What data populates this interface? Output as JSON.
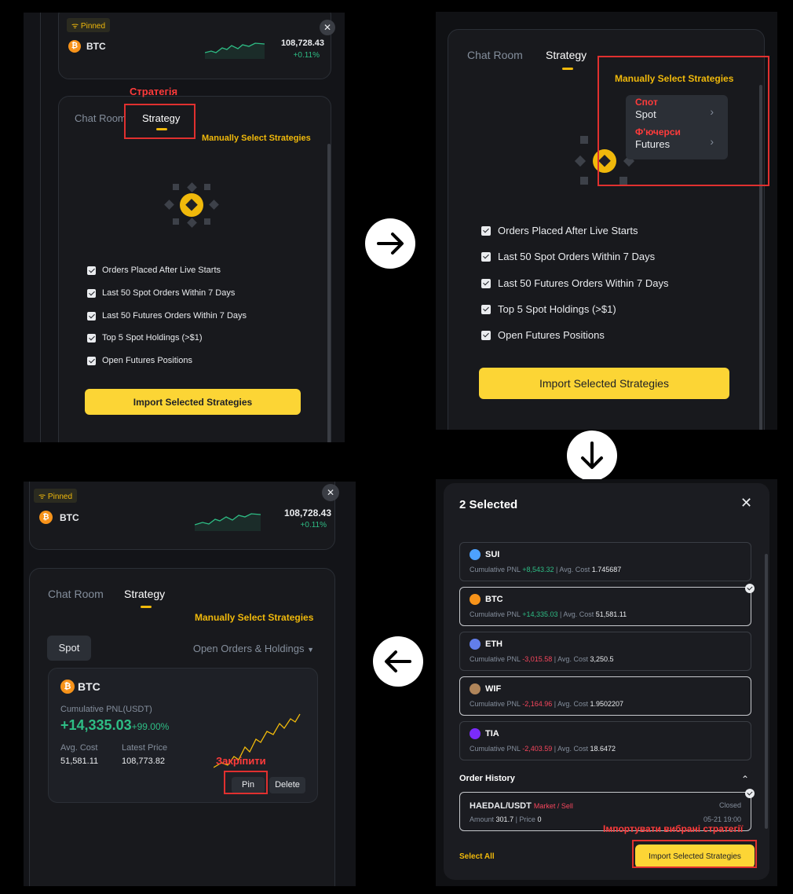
{
  "panel1": {
    "pinned_label": "Pinned",
    "symbol": "BTC",
    "price": "108,728.43",
    "change": "+0.11%",
    "tab_chat": "Chat Room",
    "tab_strategy": "Strategy",
    "annotation": "Стратегія",
    "manual_select": "Manually Select Strategies",
    "options": [
      "Orders Placed After Live Starts",
      "Last 50 Spot Orders Within 7 Days",
      "Last 50 Futures Orders Within 7 Days",
      "Top 5 Spot Holdings (>$1)",
      "Open Futures Positions"
    ],
    "import_button": "Import Selected Strategies"
  },
  "panel2": {
    "tab_chat": "Chat Room",
    "tab_strategy": "Strategy",
    "manual_select": "Manually Select Strategies",
    "menu": [
      {
        "annotation": "Спот",
        "label": "Spot"
      },
      {
        "annotation": "Ф'ючерси",
        "label": "Futures"
      }
    ],
    "options": [
      "Orders Placed After Live Starts",
      "Last 50 Spot Orders Within 7 Days",
      "Last 50 Futures Orders Within 7 Days",
      "Top 5 Spot Holdings (>$1)",
      "Open Futures Positions"
    ],
    "import_button": "Import Selected Strategies"
  },
  "panel3": {
    "pinned_label": "Pinned",
    "symbol": "BTC",
    "price": "108,728.43",
    "change": "+0.11%",
    "tab_chat": "Chat Room",
    "tab_strategy": "Strategy",
    "manual_select": "Manually Select Strategies",
    "spot_pill": "Spot",
    "dropdown": "Open Orders & Holdings",
    "card": {
      "symbol": "BTC",
      "pnl_label": "Cumulative PNL(USDT)",
      "pnl_value": "+14,335.03",
      "pnl_pct": "+99.00%",
      "avg_cost_label": "Avg. Cost",
      "avg_cost": "51,581.11",
      "latest_label": "Latest Price",
      "latest_price": "108,773.82",
      "annotation": "Закріпити",
      "pin": "Pin",
      "delete": "Delete"
    }
  },
  "panel4": {
    "title": "2 Selected",
    "pnl_label": "Cumulative PNL",
    "avg_label": "Avg. Cost",
    "coins": [
      {
        "name": "SUI",
        "pnl": "+8,543.32",
        "avg": "1.745687",
        "selected": false,
        "color": "#4da2ff",
        "sign": "pos"
      },
      {
        "name": "BTC",
        "pnl": "+14,335.03",
        "avg": "51,581.11",
        "selected": true,
        "color": "#f7931a",
        "sign": "pos"
      },
      {
        "name": "ETH",
        "pnl": "-3,015.58",
        "avg": "3,250.5",
        "selected": false,
        "color": "#627eea",
        "sign": "neg"
      },
      {
        "name": "WIF",
        "pnl": "-2,164.96",
        "avg": "1.9502207",
        "selected": true,
        "color": "#b0855a",
        "sign": "neg"
      },
      {
        "name": "TIA",
        "pnl": "-2,403.59",
        "avg": "18.6472",
        "selected": false,
        "color": "#7b2bf9",
        "sign": "neg"
      }
    ],
    "order_history": "Order History",
    "order": {
      "pair": "HAEDAL/USDT",
      "type": "Market / Sell",
      "status": "Closed",
      "amount_label": "Amount",
      "amount": "301.7",
      "price_label": "Price",
      "price": "0",
      "date": "05-21 19:00"
    },
    "annotation": "Імпортувати вибрані стратегії",
    "select_all": "Select All",
    "import_button": "Import Selected Strategies"
  }
}
